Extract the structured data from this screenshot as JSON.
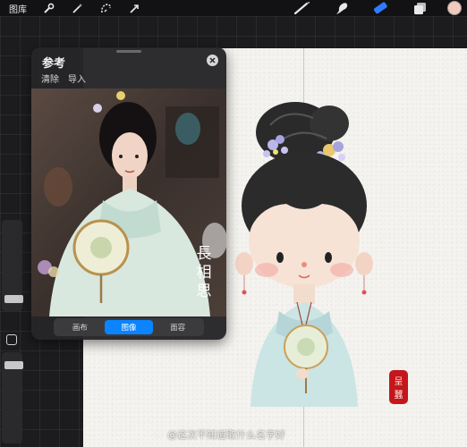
{
  "toolbar": {
    "gallery_label": "图库",
    "left_tools": [
      "wrench-icon",
      "magic-wand-icon",
      "selection-icon",
      "transform-arrow-icon"
    ],
    "right_tools": [
      "brush-icon",
      "smudge-icon",
      "eraser-icon",
      "layers-icon"
    ],
    "active_tool": "eraser-icon",
    "active_tool_color": "#2f7bff",
    "current_color": "#f1c9bd"
  },
  "reference": {
    "title": "参考",
    "clear_label": "清除",
    "import_label": "导入",
    "photo_caption": "長相思",
    "modes": [
      "画布",
      "图像",
      "面容"
    ],
    "active_mode": "图像",
    "active_mode_color": "#0a84ff"
  },
  "canvas": {
    "seal_text": "呈\n蠶"
  },
  "watermark": {
    "text": "@这次不知道取什么名字好"
  }
}
